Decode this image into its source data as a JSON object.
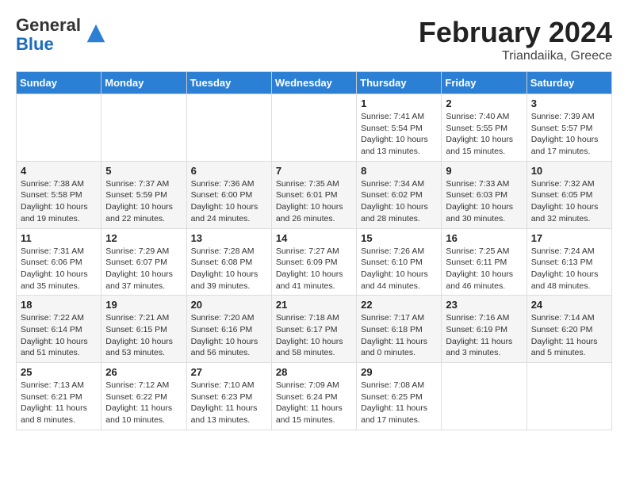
{
  "header": {
    "logo_general": "General",
    "logo_blue": "Blue",
    "main_title": "February 2024",
    "subtitle": "Triandaiika, Greece"
  },
  "calendar": {
    "days_of_week": [
      "Sunday",
      "Monday",
      "Tuesday",
      "Wednesday",
      "Thursday",
      "Friday",
      "Saturday"
    ],
    "weeks": [
      [
        {
          "num": "",
          "info": ""
        },
        {
          "num": "",
          "info": ""
        },
        {
          "num": "",
          "info": ""
        },
        {
          "num": "",
          "info": ""
        },
        {
          "num": "1",
          "info": "Sunrise: 7:41 AM\nSunset: 5:54 PM\nDaylight: 10 hours and 13 minutes."
        },
        {
          "num": "2",
          "info": "Sunrise: 7:40 AM\nSunset: 5:55 PM\nDaylight: 10 hours and 15 minutes."
        },
        {
          "num": "3",
          "info": "Sunrise: 7:39 AM\nSunset: 5:57 PM\nDaylight: 10 hours and 17 minutes."
        }
      ],
      [
        {
          "num": "4",
          "info": "Sunrise: 7:38 AM\nSunset: 5:58 PM\nDaylight: 10 hours and 19 minutes."
        },
        {
          "num": "5",
          "info": "Sunrise: 7:37 AM\nSunset: 5:59 PM\nDaylight: 10 hours and 22 minutes."
        },
        {
          "num": "6",
          "info": "Sunrise: 7:36 AM\nSunset: 6:00 PM\nDaylight: 10 hours and 24 minutes."
        },
        {
          "num": "7",
          "info": "Sunrise: 7:35 AM\nSunset: 6:01 PM\nDaylight: 10 hours and 26 minutes."
        },
        {
          "num": "8",
          "info": "Sunrise: 7:34 AM\nSunset: 6:02 PM\nDaylight: 10 hours and 28 minutes."
        },
        {
          "num": "9",
          "info": "Sunrise: 7:33 AM\nSunset: 6:03 PM\nDaylight: 10 hours and 30 minutes."
        },
        {
          "num": "10",
          "info": "Sunrise: 7:32 AM\nSunset: 6:05 PM\nDaylight: 10 hours and 32 minutes."
        }
      ],
      [
        {
          "num": "11",
          "info": "Sunrise: 7:31 AM\nSunset: 6:06 PM\nDaylight: 10 hours and 35 minutes."
        },
        {
          "num": "12",
          "info": "Sunrise: 7:29 AM\nSunset: 6:07 PM\nDaylight: 10 hours and 37 minutes."
        },
        {
          "num": "13",
          "info": "Sunrise: 7:28 AM\nSunset: 6:08 PM\nDaylight: 10 hours and 39 minutes."
        },
        {
          "num": "14",
          "info": "Sunrise: 7:27 AM\nSunset: 6:09 PM\nDaylight: 10 hours and 41 minutes."
        },
        {
          "num": "15",
          "info": "Sunrise: 7:26 AM\nSunset: 6:10 PM\nDaylight: 10 hours and 44 minutes."
        },
        {
          "num": "16",
          "info": "Sunrise: 7:25 AM\nSunset: 6:11 PM\nDaylight: 10 hours and 46 minutes."
        },
        {
          "num": "17",
          "info": "Sunrise: 7:24 AM\nSunset: 6:13 PM\nDaylight: 10 hours and 48 minutes."
        }
      ],
      [
        {
          "num": "18",
          "info": "Sunrise: 7:22 AM\nSunset: 6:14 PM\nDaylight: 10 hours and 51 minutes."
        },
        {
          "num": "19",
          "info": "Sunrise: 7:21 AM\nSunset: 6:15 PM\nDaylight: 10 hours and 53 minutes."
        },
        {
          "num": "20",
          "info": "Sunrise: 7:20 AM\nSunset: 6:16 PM\nDaylight: 10 hours and 56 minutes."
        },
        {
          "num": "21",
          "info": "Sunrise: 7:18 AM\nSunset: 6:17 PM\nDaylight: 10 hours and 58 minutes."
        },
        {
          "num": "22",
          "info": "Sunrise: 7:17 AM\nSunset: 6:18 PM\nDaylight: 11 hours and 0 minutes."
        },
        {
          "num": "23",
          "info": "Sunrise: 7:16 AM\nSunset: 6:19 PM\nDaylight: 11 hours and 3 minutes."
        },
        {
          "num": "24",
          "info": "Sunrise: 7:14 AM\nSunset: 6:20 PM\nDaylight: 11 hours and 5 minutes."
        }
      ],
      [
        {
          "num": "25",
          "info": "Sunrise: 7:13 AM\nSunset: 6:21 PM\nDaylight: 11 hours and 8 minutes."
        },
        {
          "num": "26",
          "info": "Sunrise: 7:12 AM\nSunset: 6:22 PM\nDaylight: 11 hours and 10 minutes."
        },
        {
          "num": "27",
          "info": "Sunrise: 7:10 AM\nSunset: 6:23 PM\nDaylight: 11 hours and 13 minutes."
        },
        {
          "num": "28",
          "info": "Sunrise: 7:09 AM\nSunset: 6:24 PM\nDaylight: 11 hours and 15 minutes."
        },
        {
          "num": "29",
          "info": "Sunrise: 7:08 AM\nSunset: 6:25 PM\nDaylight: 11 hours and 17 minutes."
        },
        {
          "num": "",
          "info": ""
        },
        {
          "num": "",
          "info": ""
        }
      ]
    ]
  }
}
